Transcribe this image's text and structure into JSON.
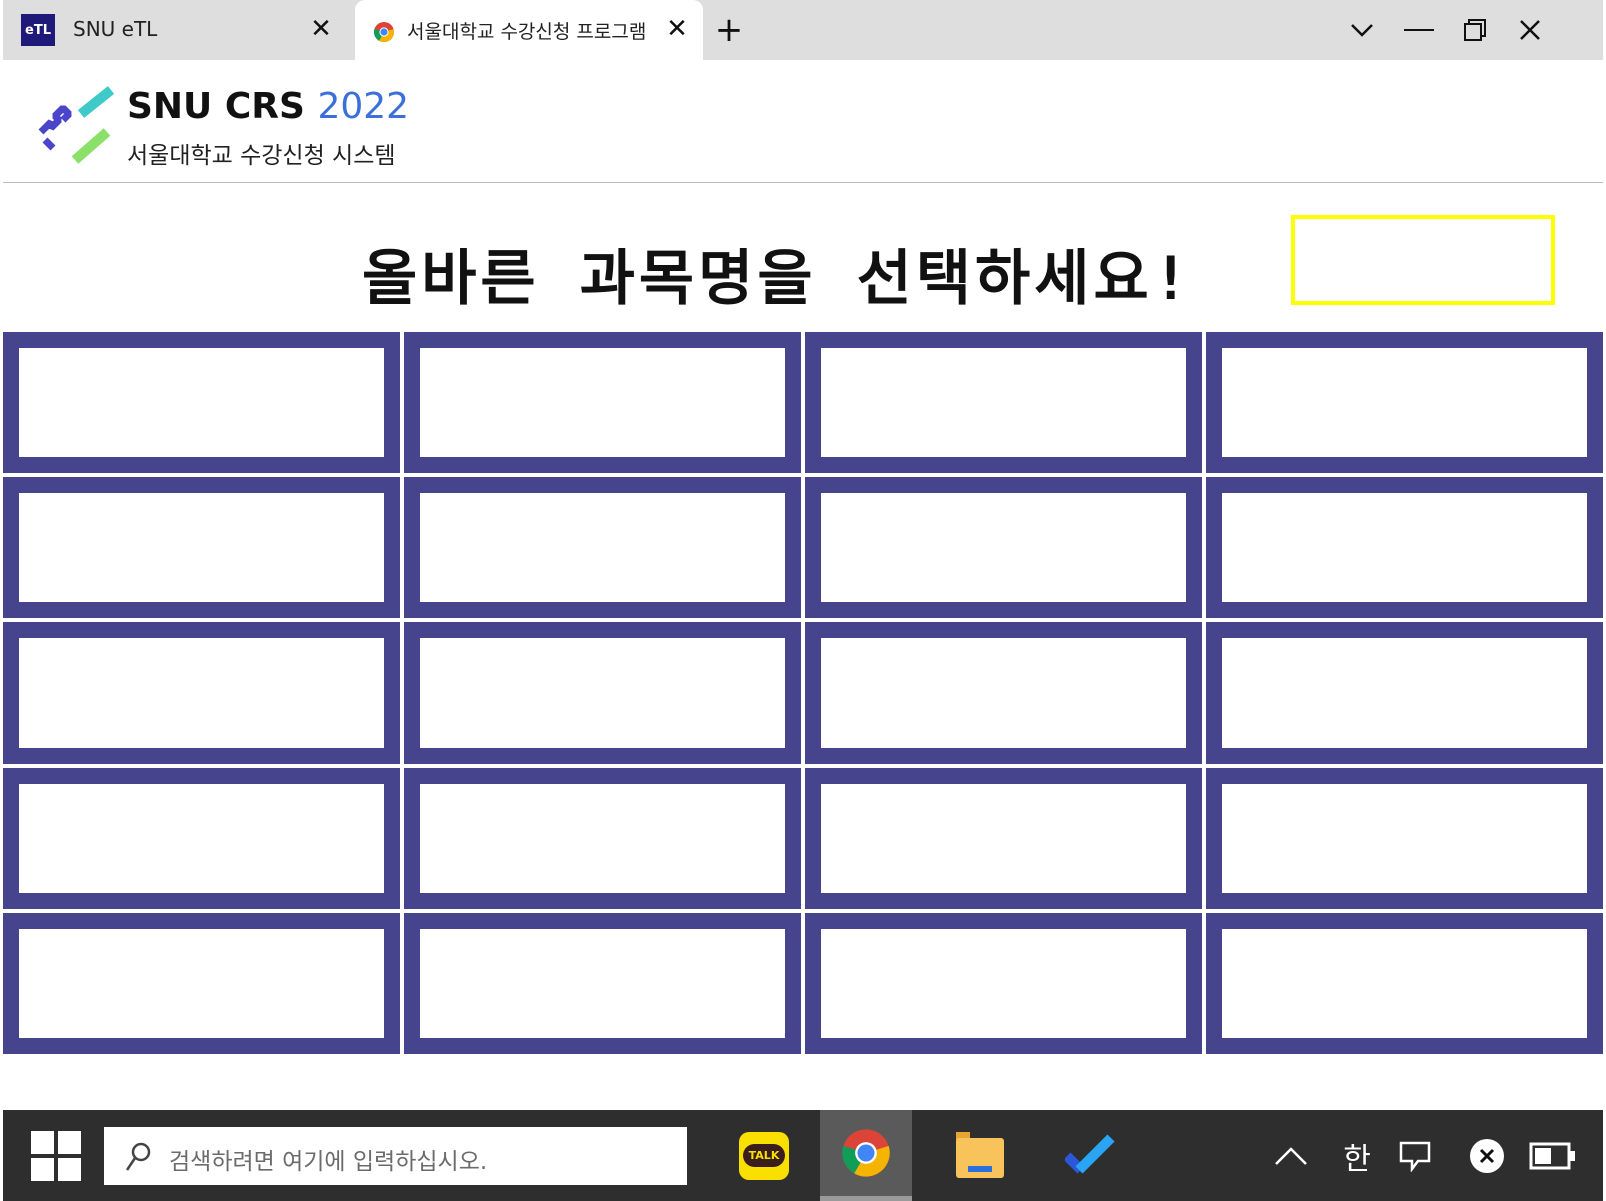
{
  "browser": {
    "tabs": [
      {
        "favicon_text": "eTL",
        "title": "SNU eTL",
        "active": false
      },
      {
        "favicon": "chrome-icon",
        "title": "서울대학교 수강신청 프로그램",
        "active": true
      }
    ],
    "new_tab_symbol": "+",
    "close_symbol": "✕",
    "window_controls": [
      "chevron-down-icon",
      "minimize-icon",
      "restore-icon",
      "close-icon"
    ]
  },
  "site": {
    "brand_main": "SNU CRS",
    "brand_year": "2022",
    "brand_sub": "서울대학교 수강신청 시스템"
  },
  "game": {
    "prompt": "올바른 과목명을 선택하세요!",
    "answer_value": "",
    "rows": 5,
    "columns": 4,
    "options": [
      "",
      "",
      "",
      "",
      "",
      "",
      "",
      "",
      "",
      "",
      "",
      "",
      "",
      "",
      "",
      "",
      "",
      "",
      "",
      ""
    ]
  },
  "taskbar": {
    "search_placeholder": "검색하려면 여기에 입력하십시오.",
    "kakao_label": "TALK",
    "ime_label": "한",
    "apps": [
      "kakaotalk-icon",
      "chrome-icon",
      "file-explorer-icon",
      "todo-icon"
    ]
  },
  "colors": {
    "cell_border": "#45448c",
    "answer_box_border": "#ffff00",
    "brand_year": "#3b6fd9",
    "taskbar_bg": "#2e2e2e"
  }
}
